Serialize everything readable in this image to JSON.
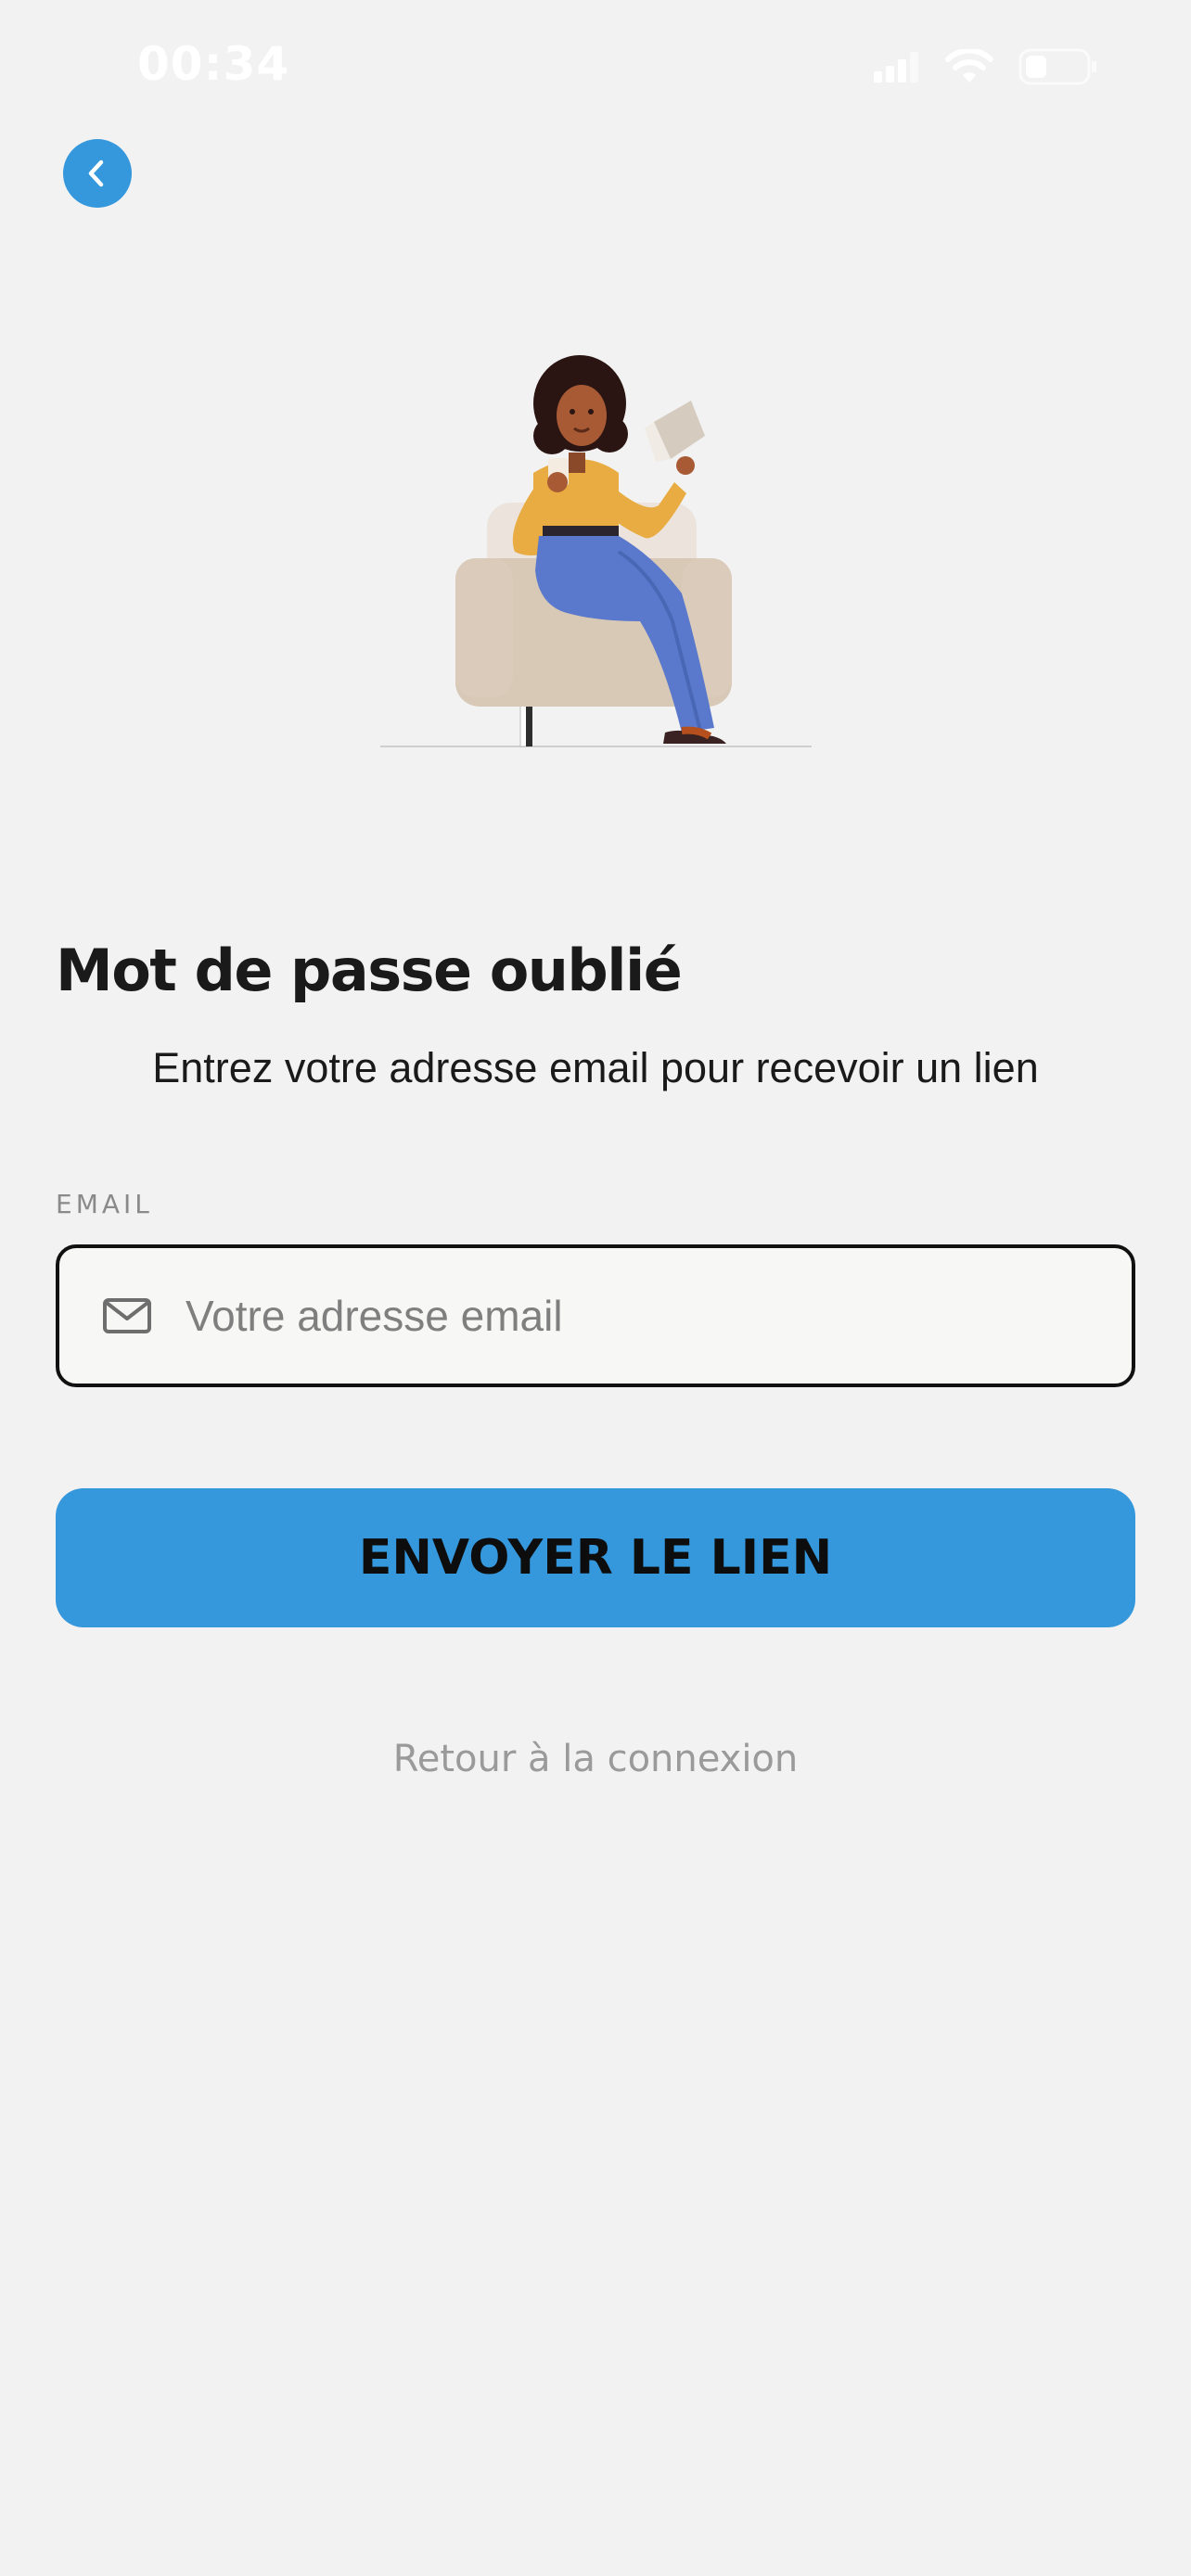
{
  "status_bar": {
    "time": "00:34"
  },
  "icons": {
    "back": "chevron-left-icon",
    "signal": "cellular-signal-icon",
    "wifi": "wifi-icon",
    "battery": "battery-icon",
    "email": "mail-icon"
  },
  "colors": {
    "accent": "#3597dc",
    "background": "#f2f2f2",
    "text": "#1a1a1a",
    "muted": "#9a9a9a"
  },
  "page": {
    "title": "Mot de passe oublié",
    "subtitle": "Entrez votre adresse email pour recevoir un lien"
  },
  "form": {
    "email_label": "EMAIL",
    "email_value": "",
    "email_placeholder": "Votre adresse email",
    "submit_label": "ENVOYER LE LIEN"
  },
  "footer": {
    "back_to_login": "Retour à la connexion"
  }
}
